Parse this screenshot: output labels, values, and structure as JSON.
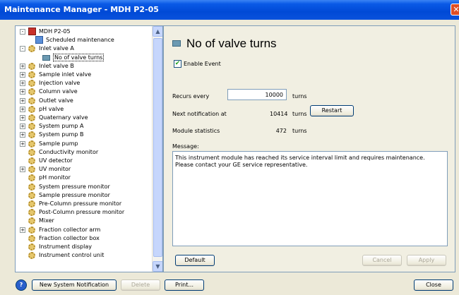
{
  "window": {
    "title": "Maintenance Manager - MDH P2-05",
    "close_glyph": "✕"
  },
  "tree": {
    "items": [
      {
        "label": "MDH P2-05",
        "expander": "-",
        "icon": "system-icon",
        "indent": 0
      },
      {
        "label": "Scheduled maintenance",
        "expander": "",
        "icon": "calendar-icon",
        "indent": 1
      },
      {
        "label": "Inlet valve A",
        "expander": "-",
        "icon": "gear-icon",
        "indent": 0
      },
      {
        "label": "No of valve turns",
        "expander": "",
        "icon": "counter-icon",
        "indent": 2,
        "selected": true
      },
      {
        "label": "Inlet valve B",
        "expander": "+",
        "icon": "gear-icon",
        "indent": 0
      },
      {
        "label": "Sample inlet valve",
        "expander": "+",
        "icon": "gear-icon",
        "indent": 0
      },
      {
        "label": "Injection valve",
        "expander": "+",
        "icon": "gear-icon",
        "indent": 0
      },
      {
        "label": "Column valve",
        "expander": "+",
        "icon": "gear-icon",
        "indent": 0
      },
      {
        "label": "Outlet valve",
        "expander": "+",
        "icon": "gear-icon",
        "indent": 0
      },
      {
        "label": "pH valve",
        "expander": "+",
        "icon": "gear-icon",
        "indent": 0
      },
      {
        "label": "Quaternary valve",
        "expander": "+",
        "icon": "gear-icon",
        "indent": 0
      },
      {
        "label": "System pump A",
        "expander": "+",
        "icon": "gear-icon",
        "indent": 0
      },
      {
        "label": "System pump B",
        "expander": "+",
        "icon": "gear-icon",
        "indent": 0
      },
      {
        "label": "Sample pump",
        "expander": "+",
        "icon": "gear-icon",
        "indent": 0
      },
      {
        "label": "Conductivity monitor",
        "expander": "",
        "icon": "gear-icon",
        "indent": 0
      },
      {
        "label": "UV detector",
        "expander": "",
        "icon": "gear-icon",
        "indent": 0
      },
      {
        "label": "UV monitor",
        "expander": "+",
        "icon": "gear-icon",
        "indent": 0
      },
      {
        "label": "pH monitor",
        "expander": "",
        "icon": "gear-icon",
        "indent": 0
      },
      {
        "label": "System pressure monitor",
        "expander": "",
        "icon": "gear-icon",
        "indent": 0
      },
      {
        "label": "Sample pressure monitor",
        "expander": "",
        "icon": "gear-icon",
        "indent": 0
      },
      {
        "label": "Pre-Column pressure monitor",
        "expander": "",
        "icon": "gear-icon",
        "indent": 0
      },
      {
        "label": "Post-Column pressure monitor",
        "expander": "",
        "icon": "gear-icon",
        "indent": 0
      },
      {
        "label": "Mixer",
        "expander": "",
        "icon": "gear-icon",
        "indent": 0
      },
      {
        "label": "Fraction collector arm",
        "expander": "+",
        "icon": "gear-icon",
        "indent": 0
      },
      {
        "label": "Fraction collector box",
        "expander": "",
        "icon": "gear-icon",
        "indent": 0
      },
      {
        "label": "Instrument display",
        "expander": "",
        "icon": "gear-icon",
        "indent": 0
      },
      {
        "label": "Instrument control unit",
        "expander": "",
        "icon": "gear-icon",
        "indent": 0
      }
    ],
    "scroll_up": "▲",
    "scroll_down": "▼"
  },
  "detail": {
    "title": "No of valve turns",
    "enable_event_label": "Enable Event",
    "enable_event_checked": true,
    "check_glyph": "✔",
    "recurs_label": "Recurs every",
    "recurs_value": "10000",
    "recurs_unit": "turns",
    "next_label": "Next notification at",
    "next_value": "10414",
    "next_unit": "turns",
    "restart_button": "Restart",
    "stats_label": "Module statistics",
    "stats_value": "472",
    "stats_unit": "turns",
    "message_label": "Message:",
    "message_text": "This instrument module has reached its service interval limit and requires maintenance. Please contact your GE service representative.",
    "default_button": "Default",
    "cancel_button": "Cancel",
    "apply_button": "Apply"
  },
  "footer": {
    "help_glyph": "?",
    "new_notification_button": "New System Notification",
    "delete_button": "Delete",
    "print_button": "Print...",
    "close_button": "Close"
  }
}
